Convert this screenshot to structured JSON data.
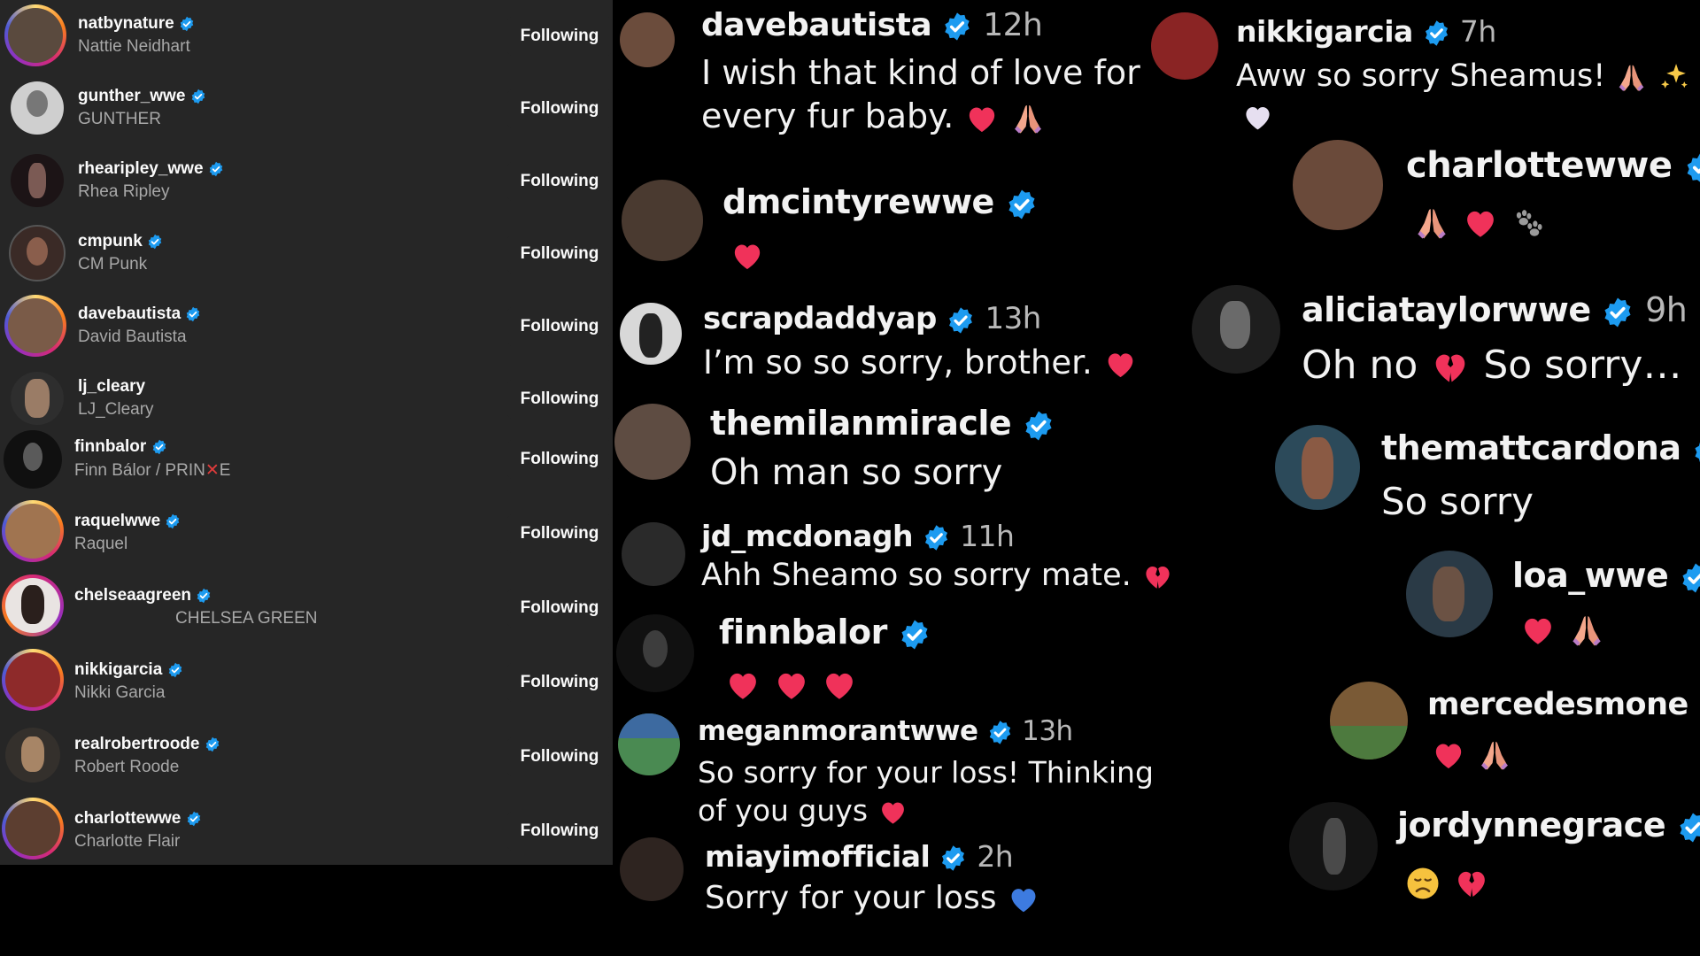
{
  "following_list": {
    "button_label": "Following",
    "accounts": [
      {
        "username": "natbynature",
        "display_name": "Nattie Neidhart"
      },
      {
        "username": "gunther_wwe",
        "display_name": "GUNTHER"
      },
      {
        "username": "rhearipley_wwe",
        "display_name": "Rhea Ripley"
      },
      {
        "username": "cmpunk",
        "display_name": "CM Punk"
      },
      {
        "username": "davebautista",
        "display_name": "David Bautista"
      },
      {
        "username": "lj_cleary",
        "display_name": "LJ_Cleary"
      },
      {
        "username": "finnbalor",
        "display_name_before": "Finn Bálor / PRIN",
        "display_name_after": "E"
      },
      {
        "username": "raquelwwe",
        "display_name": "Raquel"
      },
      {
        "username": "chelseaagreen",
        "display_name": "CHELSEA GREEN"
      },
      {
        "username": "nikkigarcia",
        "display_name": "Nikki Garcia"
      },
      {
        "username": "realrobertroode",
        "display_name": "Robert Roode"
      },
      {
        "username": "charlottewwe",
        "display_name": "Charlotte Flair"
      }
    ]
  },
  "comments_middle": [
    {
      "username": "davebautista",
      "time": "12h",
      "text_line1": "I wish that kind of love for",
      "text_line2": "every fur baby."
    },
    {
      "username": "dmcintyrewwe",
      "time": "",
      "text_line1": ""
    },
    {
      "username": "scrapdaddyap",
      "time": "13h",
      "text_line1": "I’m so so sorry, brother."
    },
    {
      "username": "themilanmiracle",
      "time": "",
      "text_line1": "Oh man so sorry"
    },
    {
      "username": "jd_mcdonagh",
      "time": "11h",
      "text_line1": "Ahh Sheamo so sorry mate."
    },
    {
      "username": "finnbalor",
      "time": "",
      "text_line1": ""
    },
    {
      "username": "meganmorantwwe",
      "time": "13h",
      "text_line1": "So sorry for your loss! Thinking",
      "text_line2": "of you guys"
    },
    {
      "username": "miayimofficial",
      "time": "2h",
      "text_line1": "Sorry for your loss"
    }
  ],
  "comments_right": [
    {
      "username": "nikkigarcia",
      "time": "7h",
      "text_line1": "Aww so sorry Sheamus!"
    },
    {
      "username": "charlottewwe",
      "time": "",
      "text_line1": ""
    },
    {
      "username": "aliciataylorwwe",
      "time": "9h",
      "text_line1": "Oh no",
      "text_line2": "So sorry…"
    },
    {
      "username": "themattcardona",
      "time": "",
      "text_line1": "So sorry"
    },
    {
      "username": "loa_wwe",
      "time": "",
      "text_line1": ""
    },
    {
      "username": "mercedesmone",
      "time": "",
      "text_line1": ""
    },
    {
      "username": "jordynnegrace",
      "time": "",
      "text_line1": ""
    }
  ],
  "icons": {
    "verified": "verified-badge-icon",
    "emojis": [
      "red-heart",
      "folded-hands",
      "sparkles",
      "white-heart",
      "paw-prints",
      "broken-heart",
      "blue-heart",
      "disappointed-face"
    ]
  },
  "colors": {
    "panel_bg": "#262626",
    "page_bg": "#000000",
    "verified_blue": "#1d9bf0",
    "heart_red": "#f0325a",
    "muted_text": "#a8a8a8"
  }
}
